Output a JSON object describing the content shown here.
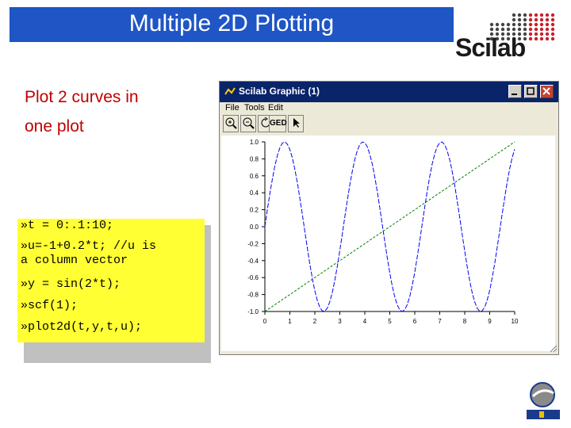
{
  "slide": {
    "title": "Multiple 2D Plotting"
  },
  "logo": {
    "text": "Scilab"
  },
  "bullet": {
    "line1": "Plot 2 curves in",
    "line2": "one plot"
  },
  "code": [
    "»t = 0:.1:10;",
    "»u=-1+0.2*t; //u is",
    "a column vector",
    "»y = sin(2*t);",
    "»scf(1);",
    "»plot2d(t,y,t,u);"
  ],
  "window": {
    "title": "Scilab Graphic (1)",
    "menu": [
      "File",
      "Tools",
      "Edit"
    ],
    "toolbar": [
      "zoom-in-icon",
      "zoom-out-icon",
      "rotate-icon",
      "GED",
      "pointer-icon"
    ],
    "controls": [
      "minimize-icon",
      "maximize-icon",
      "close-icon"
    ]
  },
  "chart_data": {
    "type": "line",
    "title": "",
    "xlabel": "",
    "ylabel": "",
    "xlim": [
      0,
      10
    ],
    "ylim": [
      -1.0,
      1.0
    ],
    "x_ticks": [
      "0",
      "1",
      "2",
      "3",
      "4",
      "5",
      "6",
      "7",
      "8",
      "9",
      "10"
    ],
    "y_ticks": [
      "1.0",
      "0.8",
      "0.6",
      "0.4",
      "0.2",
      "0.0",
      "-0.2",
      "-0.4",
      "-0.6",
      "-0.8",
      "-1.0"
    ],
    "series": [
      {
        "color": "#0000ff",
        "formula": "sin(2*t)",
        "x_range": [
          0,
          10
        ],
        "step": 0.1
      },
      {
        "color": "#008000",
        "formula": "-1+0.2*t",
        "x_range": [
          0,
          10
        ],
        "step": 0.1
      }
    ]
  }
}
